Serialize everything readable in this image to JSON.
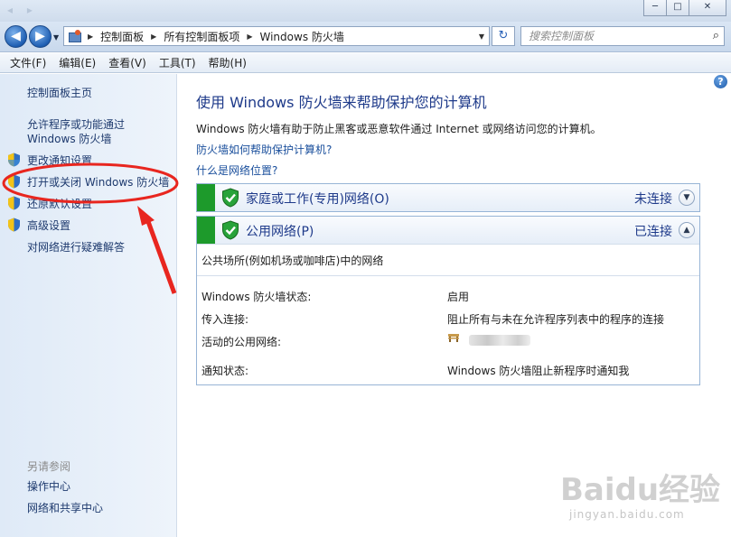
{
  "titlebar": {
    "minimize": "─",
    "maximize": "□",
    "close": "✕"
  },
  "navigation": {
    "back": "◀",
    "forward": "▶"
  },
  "address": {
    "crumbs": [
      "控制面板",
      "所有控制面板项",
      "Windows 防火墙"
    ]
  },
  "search": {
    "placeholder": "搜索控制面板"
  },
  "menu": [
    "文件(F)",
    "编辑(E)",
    "查看(V)",
    "工具(T)",
    "帮助(H)"
  ],
  "sidebar": {
    "home": "控制面板主页",
    "allow_programs": "允许程序或功能通过 Windows 防火墙",
    "change_notifications": "更改通知设置",
    "turn_on_off": "打开或关闭 Windows 防火墙",
    "restore_defaults": "还原默认设置",
    "advanced": "高级设置",
    "troubleshoot": "对网络进行疑难解答",
    "see_also": "另请参阅",
    "action_center": "操作中心",
    "network_center": "网络和共享中心"
  },
  "main": {
    "title": "使用 Windows 防火墙来帮助保护您的计算机",
    "description": "Windows 防火墙有助于防止黑客或恶意软件通过 Internet 或网络访问您的计算机。",
    "link_how": "防火墙如何帮助保护计算机?",
    "link_location": "什么是网络位置?"
  },
  "networks": {
    "home": {
      "name": "家庭或工作(专用)网络(O)",
      "status": "未连接"
    },
    "public": {
      "name": "公用网络(P)",
      "status": "已连接",
      "description": "公共场所(例如机场或咖啡店)中的网络",
      "rows": [
        {
          "label": "Windows 防火墙状态:",
          "value": "启用"
        },
        {
          "label": "传入连接:",
          "value": "阻止所有与未在允许程序列表中的程序的连接"
        },
        {
          "label": "活动的公用网络:",
          "value": ""
        },
        {
          "label": "通知状态:",
          "value": "Windows 防火墙阻止新程序时通知我"
        }
      ]
    }
  },
  "help": "?",
  "colors": {
    "accent_green": "#1d9a2b",
    "link_blue": "#1a4f9c",
    "annotation_red": "#e8261f"
  },
  "watermark": {
    "brand": "Baidu经验",
    "sub": "jingyan.baidu.com"
  }
}
